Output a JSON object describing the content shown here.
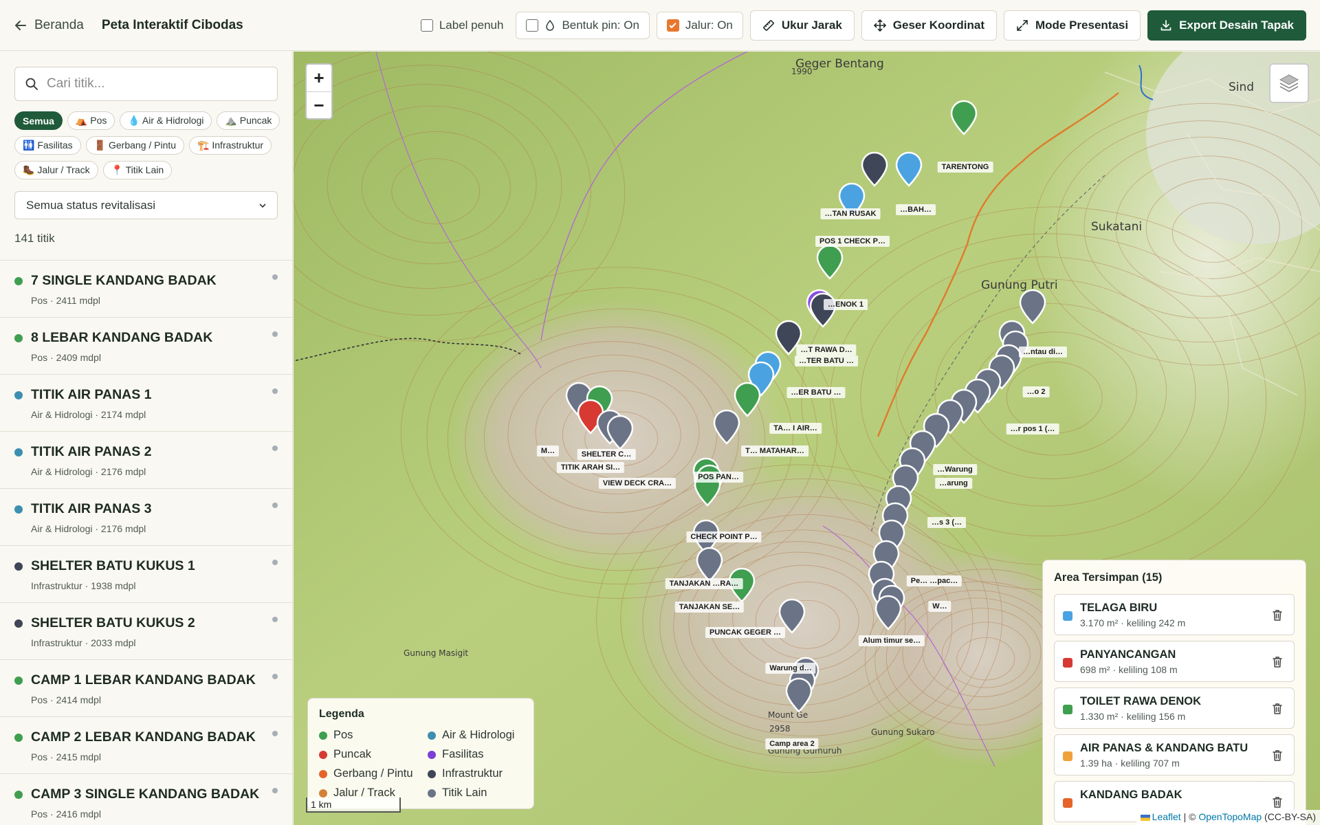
{
  "header": {
    "back_label": "Beranda",
    "title": "Peta Interaktif Cibodas",
    "toggles": [
      {
        "label": "Label penuh",
        "checked": false,
        "boxed": false
      },
      {
        "label": "Bentuk pin: On",
        "checked": false,
        "boxed": true,
        "icon": "droplet-icon"
      },
      {
        "label": "Jalur: On",
        "checked": true,
        "boxed": true
      }
    ],
    "buttons": {
      "measure": "Ukur Jarak",
      "shift": "Geser Koordinat",
      "present": "Mode Presentasi",
      "export": "Export Desain Tapak"
    }
  },
  "sidebar": {
    "search_placeholder": "Cari titik...",
    "chips": [
      {
        "label": "Semua",
        "active": true
      },
      {
        "label": "⛺ Pos"
      },
      {
        "label": "💧 Air & Hidrologi"
      },
      {
        "label": "⛰️ Puncak"
      },
      {
        "label": "🚻 Fasilitas"
      },
      {
        "label": "🚪 Gerbang / Pintu"
      },
      {
        "label": "🏗️ Infrastruktur"
      },
      {
        "label": "🥾 Jalur / Track"
      },
      {
        "label": "📍 Titik Lain"
      }
    ],
    "status_filter": "Semua status revitalisasi",
    "count": "141 titik",
    "items": [
      {
        "name": "7 SINGLE KANDANG BADAK",
        "meta": "Pos · 2411 mdpl",
        "color": "#3f9e4f"
      },
      {
        "name": "8 LEBAR KANDANG BADAK",
        "meta": "Pos · 2409 mdpl",
        "color": "#3f9e4f"
      },
      {
        "name": "TITIK AIR PANAS 1",
        "meta": "Air & Hidrologi · 2174 mdpl",
        "color": "#3d8fb0"
      },
      {
        "name": "TITIK AIR PANAS 2",
        "meta": "Air & Hidrologi · 2176 mdpl",
        "color": "#3d8fb0"
      },
      {
        "name": "TITIK AIR PANAS 3",
        "meta": "Air & Hidrologi · 2176 mdpl",
        "color": "#3d8fb0"
      },
      {
        "name": "SHELTER BATU KUKUS 1",
        "meta": "Infrastruktur · 1938 mdpl",
        "color": "#3f4657"
      },
      {
        "name": "SHELTER BATU KUKUS 2",
        "meta": "Infrastruktur · 2033 mdpl",
        "color": "#3f4657"
      },
      {
        "name": "CAMP 1 LEBAR KANDANG BADAK",
        "meta": "Pos · 2414 mdpl",
        "color": "#3f9e4f"
      },
      {
        "name": "CAMP 2 LEBAR KANDANG BADAK",
        "meta": "Pos · 2415 mdpl",
        "color": "#3f9e4f"
      },
      {
        "name": "CAMP 3 SINGLE KANDANG BADAK",
        "meta": "Pos · 2416 mdpl",
        "color": "#3f9e4f"
      }
    ]
  },
  "map": {
    "zoom_in": "+",
    "zoom_out": "−",
    "scale": "1 km",
    "places": [
      "Geger Bentang",
      "Gunung Putri",
      "Sukatani",
      "Sind",
      "Gunung Masigit",
      "Gunung Sukaro",
      "Gunung Gumuruh",
      "Mount Ge",
      "2958",
      "1990"
    ],
    "marker_labels": [
      "TARENTONG",
      "…TAN RUSAK",
      "…BAH…",
      "POS 1 CHECK P…",
      "…ENOK 1",
      "…T RAWA D…",
      "…TER BATU …",
      "…ER BATU …",
      "TA… I AIR…",
      "T… MATAHAR…",
      "POS PAN…",
      "M…",
      "SHELTER C…",
      "TITIK ARAH SI…",
      "VIEW DECK CRA…",
      "CHECK POINT P…",
      "TANJAKAN …RA…",
      "TANJAKAN SE…",
      "PUNCAK GEGER …",
      "Warung d…",
      "Camp area 2",
      "…ntau di…",
      "…o 2",
      "…r pos 1 (…",
      "…Warung",
      "…arung",
      "…s 3 (…",
      "Pe… …pac…",
      "W…",
      "Alum timur se…"
    ],
    "legend_title": "Legenda",
    "legend": [
      {
        "label": "Pos",
        "color": "#3f9e4f"
      },
      {
        "label": "Air & Hidrologi",
        "color": "#3d8fb0"
      },
      {
        "label": "Puncak",
        "color": "#d63a33"
      },
      {
        "label": "Fasilitas",
        "color": "#7b3fd6"
      },
      {
        "label": "Gerbang / Pintu",
        "color": "#e4642a"
      },
      {
        "label": "Infrastruktur",
        "color": "#3f4657"
      },
      {
        "label": "Jalur / Track",
        "color": "#d3813a"
      },
      {
        "label": "Titik Lain",
        "color": "#6b7486"
      }
    ],
    "saved_title": "Area Tersimpan (15)",
    "saved_areas": [
      {
        "name": "TELAGA BIRU",
        "meta": "3.170 m² · keliling 242 m",
        "color": "#4aa3e0"
      },
      {
        "name": "PANYANCANGAN",
        "meta": "698 m² · keliling 108 m",
        "color": "#d63a33"
      },
      {
        "name": "TOILET RAWA DENOK",
        "meta": "1.330 m² · keliling 156 m",
        "color": "#3f9e4f"
      },
      {
        "name": "AIR PANAS & KANDANG BATU",
        "meta": "1.39 ha · keliling 707 m",
        "color": "#f0a23a"
      },
      {
        "name": "KANDANG BADAK",
        "meta": "",
        "color": "#e4642a"
      }
    ],
    "attribution": {
      "leaflet": "Leaflet",
      "sep": " | © ",
      "provider": "OpenTopoMap",
      "license": " (CC-BY-SA)"
    }
  }
}
